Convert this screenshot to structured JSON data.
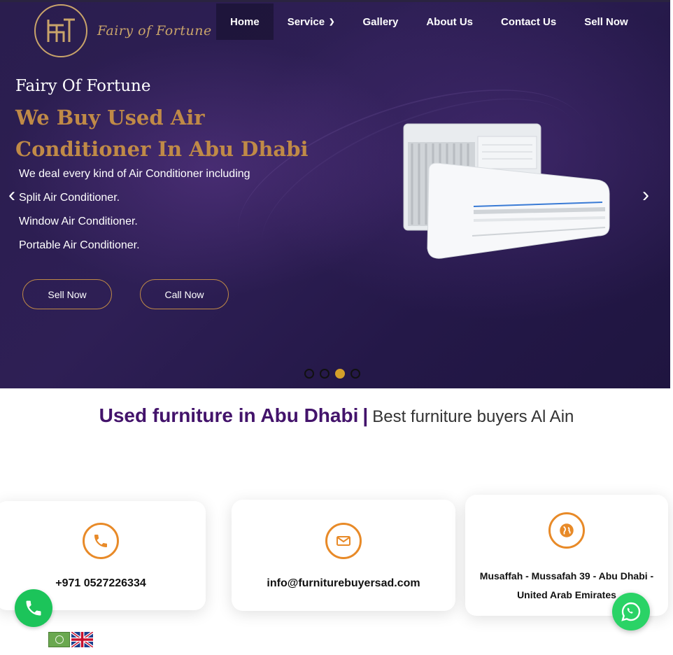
{
  "brand": {
    "logo_text": "Fairy of Fortune"
  },
  "nav": {
    "items": [
      {
        "label": "Home"
      },
      {
        "label": "Service"
      },
      {
        "label": "Gallery"
      },
      {
        "label": "About Us"
      },
      {
        "label": "Contact Us"
      },
      {
        "label": "Sell Now"
      }
    ]
  },
  "hero": {
    "brand": "Fairy Of Fortune",
    "title": "We Buy Used Air Conditioner In Abu Dhabi",
    "lines": [
      "We deal every kind of Air Conditioner including",
      "Split Air Conditioner.",
      "Window Air Conditioner.",
      "Portable Air Conditioner."
    ],
    "sell_button": "Sell Now",
    "call_button": "Call Now",
    "slides_total": 4,
    "active_slide": 3
  },
  "headline": {
    "strong": "Used furniture in Abu Dhabi",
    "separator": "|",
    "light": "Best furniture buyers Al Ain"
  },
  "contact": {
    "phone": "+971 0527226334",
    "email": "info@furniturebuyersad.com",
    "address": "Musaffah - Mussafah 39 - Abu Dhabi - United Arab Emirates"
  },
  "colors": {
    "accent": "#c08a47",
    "icon_orange": "#e88a28",
    "brand_purple": "#43136b",
    "hero_bg": "#2a1d4e",
    "whatsapp_green": "#2ad366"
  },
  "icons": {
    "phone": "phone-icon",
    "email": "envelope-icon",
    "address": "globe-icon",
    "whatsapp": "whatsapp-icon"
  }
}
